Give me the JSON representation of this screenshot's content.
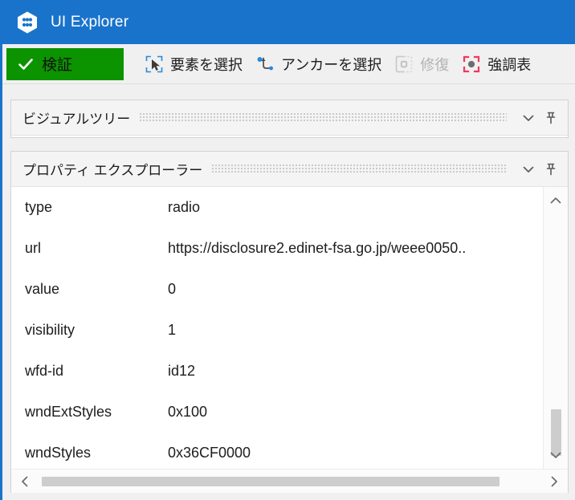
{
  "window": {
    "title": "UI Explorer",
    "logo_icon": "uipath-hex-logo-icon",
    "accent_color": "#1a73cb",
    "titlebar_text_color": "#ffffff"
  },
  "toolbar": {
    "validate": {
      "label": "検証",
      "icon": "check-icon",
      "background_color": "#0c9300",
      "enabled": true
    },
    "items": [
      {
        "name": "select-element",
        "label": "要素を選択",
        "icon": "cursor-in-box-icon",
        "enabled": true
      },
      {
        "name": "select-anchor",
        "label": "アンカーを選択",
        "icon": "anchor-point-icon",
        "enabled": true
      },
      {
        "name": "repair",
        "label": "修復",
        "icon": "dashed-box-target-icon",
        "enabled": false
      },
      {
        "name": "highlight",
        "label": "強調表",
        "icon": "highlight-brackets-icon",
        "icon_color": "#f4365d",
        "enabled": true
      }
    ]
  },
  "panels": {
    "visual_tree": {
      "title": "ビジュアルツリー",
      "collapse_icon": "chevron-down-icon",
      "pin_icon": "pin-icon"
    },
    "property_explorer": {
      "title": "プロパティ エクスプローラー",
      "collapse_icon": "chevron-down-icon",
      "pin_icon": "pin-icon",
      "rows": [
        {
          "name": "type",
          "value": "radio"
        },
        {
          "name": "url",
          "value": "https://disclosure2.edinet-fsa.go.jp/weee0050.."
        },
        {
          "name": "value",
          "value": "0"
        },
        {
          "name": "visibility",
          "value": "1"
        },
        {
          "name": "wfd-id",
          "value": "id12"
        },
        {
          "name": "wndExtStyles",
          "value": "0x100"
        },
        {
          "name": "wndStyles",
          "value": "0x36CF0000"
        }
      ],
      "vertical_scrollbar": {
        "up_icon": "chevron-up-icon",
        "down_icon": "chevron-down-icon",
        "thumb_color": "#cdcdcd"
      },
      "horizontal_scrollbar": {
        "left_icon": "chevron-left-icon",
        "right_icon": "chevron-right-icon",
        "thumb_color": "#cdcdcd"
      }
    }
  }
}
